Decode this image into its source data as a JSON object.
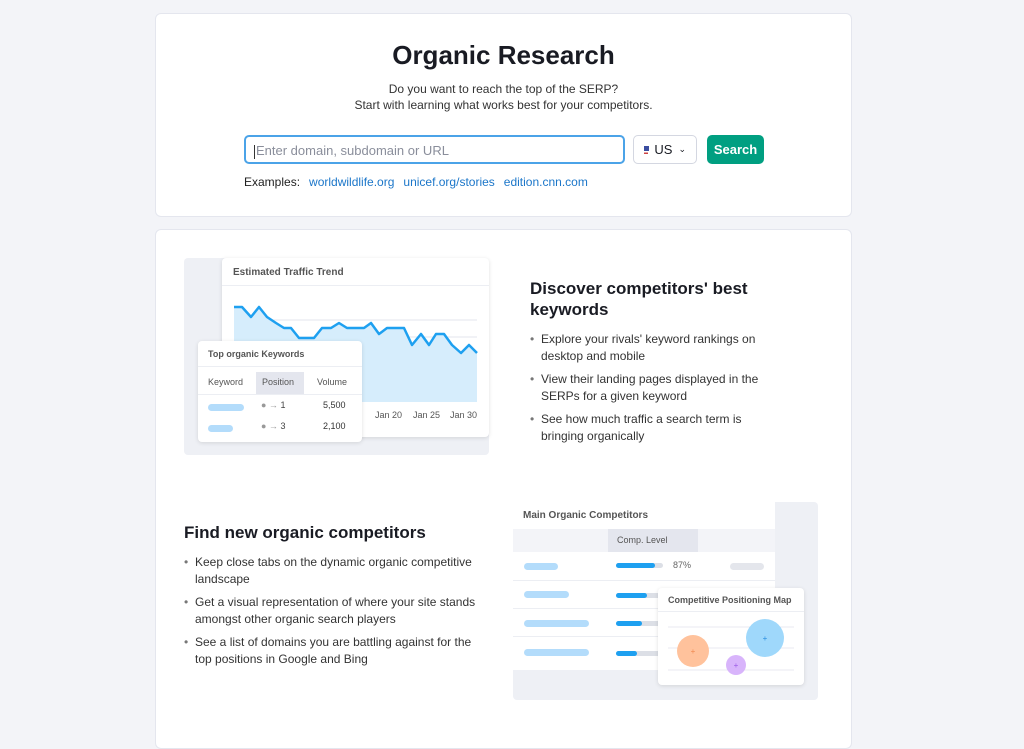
{
  "header": {
    "title": "Organic Research",
    "subtitle_line1": "Do you want to reach the top of the SERP?",
    "subtitle_line2": "Start with learning what works best for your competitors."
  },
  "search": {
    "placeholder": "Enter domain, subdomain or URL",
    "value": "",
    "database": "US",
    "database_icon": "us-flag-icon",
    "button_label": "Search",
    "button_color": "#009f81"
  },
  "examples": {
    "label": "Examples:",
    "links": [
      "worldwildlife.org",
      "unicef.org/stories",
      "edition.cnn.com"
    ]
  },
  "feature1": {
    "title": "Discover competitors' best keywords",
    "bullets": [
      "Explore your rivals' keyword rankings on desktop and mobile",
      "View their landing pages displayed in the SERPs for a given keyword",
      "See how much traffic a search term is bringing organically"
    ],
    "illustration": {
      "chart_title": "Estimated Traffic Trend",
      "x_ticks": [
        "Jan 20",
        "Jan 25",
        "Jan 30"
      ],
      "table_title": "Top organic Keywords",
      "columns": [
        "Keyword",
        "Position",
        "Volume"
      ],
      "rows": [
        {
          "position": "1",
          "volume": "5,500"
        },
        {
          "position": "3",
          "volume": "2,100"
        }
      ]
    }
  },
  "feature2": {
    "title": "Find new organic competitors",
    "bullets": [
      "Keep close tabs on the dynamic organic competitive landscape",
      "Get a visual representation of where your site stands amongst other organic search players",
      "See a list of domains you are battling against for the top positions in Google and Bing"
    ],
    "illustration": {
      "table_title": "Main Organic Competitors",
      "column": "Comp. Level",
      "first_value": "87%",
      "comp_levels": [
        87,
        65,
        55,
        45
      ],
      "map_title": "Competitive Positioning Map"
    }
  }
}
